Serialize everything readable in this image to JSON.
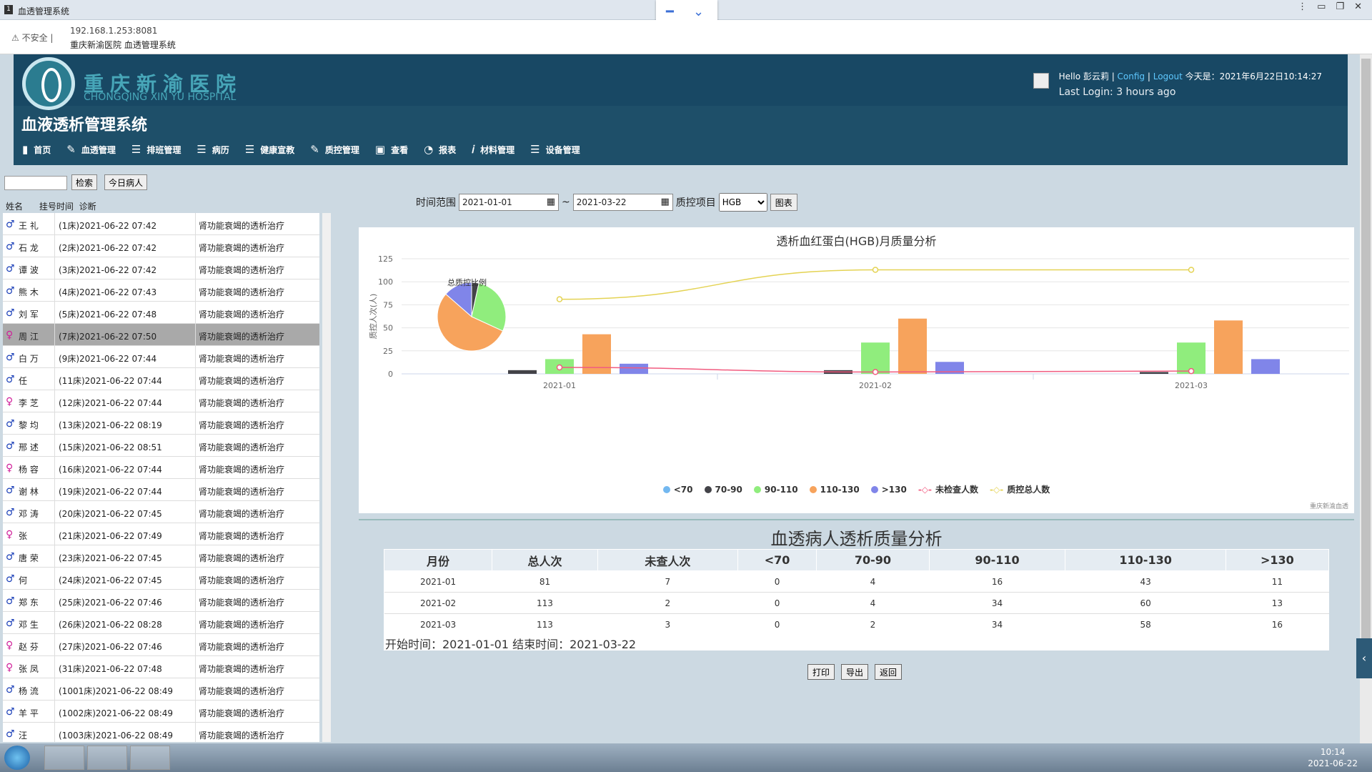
{
  "window": {
    "title": "血透管理系统",
    "tab_number": "1"
  },
  "address": {
    "security": "不安全",
    "url": "192.168.1.253:8081",
    "page_title": "重庆新渝医院 血透管理系统"
  },
  "header": {
    "hospital_cn": "重庆新渝医院",
    "hospital_en": "CHONGQING XIN YU HOSPITAL",
    "system_title": "血液透析管理系统",
    "user_hello": "Hello 彭云莉",
    "config": "Config",
    "logout": "Logout",
    "today": "今天是：2021年6月22日10:14:27",
    "last_login": "Last Login: 3 hours ago"
  },
  "nav": [
    "首页",
    "血透管理",
    "排班管理",
    "病历",
    "健康宣教",
    "质控管理",
    "查看",
    "报表",
    "材料管理",
    "设备管理"
  ],
  "sidebar": {
    "search_button": "检索",
    "today_button": "今日病人",
    "col_name": "姓名",
    "col_time": "挂号时间",
    "col_diag": "诊断",
    "patients": [
      {
        "gender": "m",
        "name": "王 礼",
        "bed": "(1床)2021-06-22 07:42",
        "diag": "肾功能衰竭的透析治疗"
      },
      {
        "gender": "m",
        "name": "石 龙",
        "bed": "(2床)2021-06-22 07:42",
        "diag": "肾功能衰竭的透析治疗"
      },
      {
        "gender": "m",
        "name": "谭 波",
        "bed": "(3床)2021-06-22 07:42",
        "diag": "肾功能衰竭的透析治疗"
      },
      {
        "gender": "m",
        "name": "熊 木",
        "bed": "(4床)2021-06-22 07:43",
        "diag": "肾功能衰竭的透析治疗"
      },
      {
        "gender": "m",
        "name": "刘 军",
        "bed": "(5床)2021-06-22 07:48",
        "diag": "肾功能衰竭的透析治疗"
      },
      {
        "gender": "f",
        "name": "周 江",
        "bed": "(7床)2021-06-22 07:50",
        "diag": "肾功能衰竭的透析治疗",
        "selected": true
      },
      {
        "gender": "m",
        "name": "白 万",
        "bed": "(9床)2021-06-22 07:44",
        "diag": "肾功能衰竭的透析治疗"
      },
      {
        "gender": "m",
        "name": "任 ",
        "bed": "(11床)2021-06-22 07:44",
        "diag": "肾功能衰竭的透析治疗"
      },
      {
        "gender": "f",
        "name": "李 芝",
        "bed": "(12床)2021-06-22 07:44",
        "diag": "肾功能衰竭的透析治疗"
      },
      {
        "gender": "m",
        "name": "黎 均",
        "bed": "(13床)2021-06-22 08:19",
        "diag": "肾功能衰竭的透析治疗"
      },
      {
        "gender": "m",
        "name": "邢 述",
        "bed": "(15床)2021-06-22 08:51",
        "diag": "肾功能衰竭的透析治疗"
      },
      {
        "gender": "f",
        "name": "杨 容",
        "bed": "(16床)2021-06-22 07:44",
        "diag": "肾功能衰竭的透析治疗"
      },
      {
        "gender": "m",
        "name": "谢 林",
        "bed": "(19床)2021-06-22 07:44",
        "diag": "肾功能衰竭的透析治疗"
      },
      {
        "gender": "m",
        "name": "邓 涛",
        "bed": "(20床)2021-06-22 07:45",
        "diag": "肾功能衰竭的透析治疗"
      },
      {
        "gender": "f",
        "name": "张 ",
        "bed": "(21床)2021-06-22 07:49",
        "diag": "肾功能衰竭的透析治疗"
      },
      {
        "gender": "m",
        "name": "唐 荣",
        "bed": "(23床)2021-06-22 07:45",
        "diag": "肾功能衰竭的透析治疗"
      },
      {
        "gender": "m",
        "name": "何 ",
        "bed": "(24床)2021-06-22 07:45",
        "diag": "肾功能衰竭的透析治疗"
      },
      {
        "gender": "m",
        "name": "郑 东",
        "bed": "(25床)2021-06-22 07:46",
        "diag": "肾功能衰竭的透析治疗"
      },
      {
        "gender": "m",
        "name": "邓 生",
        "bed": "(26床)2021-06-22 08:28",
        "diag": "肾功能衰竭的透析治疗"
      },
      {
        "gender": "f",
        "name": "赵 芬",
        "bed": "(27床)2021-06-22 07:46",
        "diag": "肾功能衰竭的透析治疗"
      },
      {
        "gender": "f",
        "name": "张 凤",
        "bed": "(31床)2021-06-22 07:48",
        "diag": "肾功能衰竭的透析治疗"
      },
      {
        "gender": "m",
        "name": "杨 流",
        "bed": "(1001床)2021-06-22 08:49",
        "diag": "肾功能衰竭的透析治疗"
      },
      {
        "gender": "m",
        "name": "羊 平",
        "bed": "(1002床)2021-06-22 08:49",
        "diag": "肾功能衰竭的透析治疗"
      },
      {
        "gender": "m",
        "name": "汪 ",
        "bed": "(1003床)2021-06-22 08:49",
        "diag": "肾功能衰竭的透析治疗"
      }
    ]
  },
  "filters": {
    "range_label": "时间范围",
    "start": "2021-01-01",
    "sep": "~",
    "end": "2021-03-22",
    "item_label": "质控项目",
    "item": "HGB",
    "chart_button": "图表"
  },
  "chart_data": {
    "type": "bar",
    "title": "透析血红蛋白(HGB)月质量分析",
    "ylabel": "质控人次(人)",
    "ylim": [
      0,
      125
    ],
    "yticks": [
      0,
      25,
      50,
      75,
      100,
      125
    ],
    "categories": [
      "2021-01",
      "2021-02",
      "2021-03"
    ],
    "series": [
      {
        "name": "<70",
        "color": "#73b8f0",
        "values": [
          0,
          0,
          0
        ]
      },
      {
        "name": "70-90",
        "color": "#434348",
        "values": [
          4,
          4,
          2
        ]
      },
      {
        "name": "90-110",
        "color": "#90ed7d",
        "values": [
          16,
          34,
          34
        ]
      },
      {
        "name": "110-130",
        "color": "#f7a35c",
        "values": [
          43,
          60,
          58
        ]
      },
      {
        "name": ">130",
        "color": "#8085e9",
        "values": [
          11,
          13,
          16
        ]
      }
    ],
    "lines": [
      {
        "name": "未检查人数",
        "color": "#f15c80",
        "values": [
          7,
          2,
          3
        ]
      },
      {
        "name": "质控总人数",
        "color": "#e4d354",
        "values": [
          81,
          113,
          113
        ]
      }
    ],
    "pie": {
      "title": "总质控比例",
      "slices": [
        {
          "name": "<70",
          "value": 0
        },
        {
          "name": "70-90",
          "value": 10
        },
        {
          "name": "90-110",
          "value": 84
        },
        {
          "name": "110-130",
          "value": 161
        },
        {
          "name": ">130",
          "value": 40
        }
      ]
    },
    "watermark": "重庆新渝血透"
  },
  "table": {
    "title": "血透病人透析质量分析",
    "headers": [
      "月份",
      "总人次",
      "未查人次",
      "<70",
      "70-90",
      "90-110",
      "110-130",
      ">130"
    ],
    "rows": [
      [
        "2021-01",
        "81",
        "7",
        "0",
        "4",
        "16",
        "43",
        "11"
      ],
      [
        "2021-02",
        "113",
        "2",
        "0",
        "4",
        "34",
        "60",
        "13"
      ],
      [
        "2021-03",
        "113",
        "3",
        "0",
        "2",
        "34",
        "58",
        "16"
      ]
    ],
    "footer": "开始时间：2021-01-01     结束时间：2021-03-22"
  },
  "actions": {
    "print": "打印",
    "export": "导出",
    "back": "返回"
  },
  "taskbar": {
    "time": "10:14",
    "date": "2021-06-22"
  }
}
